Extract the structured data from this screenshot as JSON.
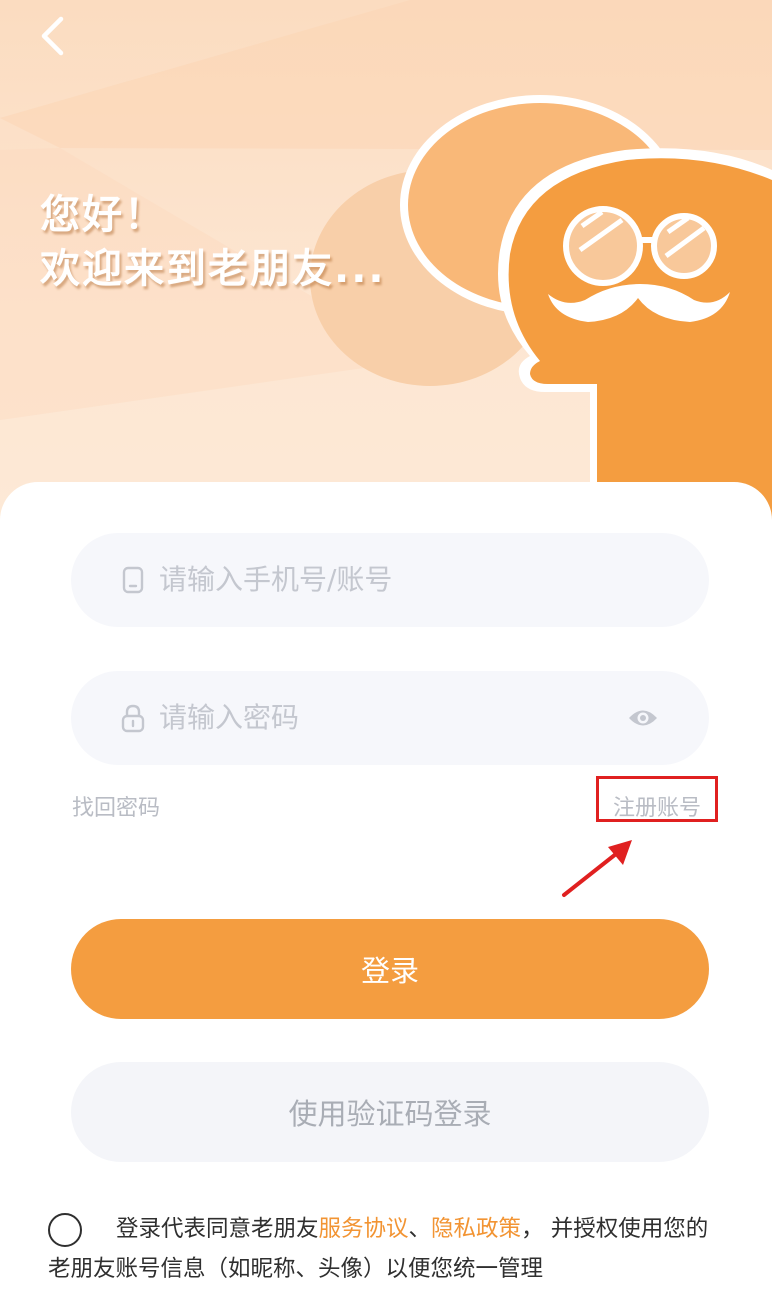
{
  "greeting": {
    "line1": "您好！",
    "line2": "欢迎来到老朋友..."
  },
  "login_form": {
    "account_placeholder": "请输入手机号/账号",
    "password_placeholder": "请输入密码",
    "forgot_password": "找回密码",
    "register": "注册账号"
  },
  "buttons": {
    "login": "登录",
    "code_login": "使用验证码登录"
  },
  "agreement": {
    "prefix": "登录代表同意老朋友",
    "service_link": "服务协议",
    "separator": "、",
    "privacy_link": "隐私政策",
    "suffix": "， 并授权使用您的老朋友账号信息（如昵称、头像）以便您统一管理"
  },
  "icons": {
    "back": "chevron-left-icon",
    "phone": "phone-icon",
    "lock": "lock-icon",
    "eye": "eye-icon",
    "mascot": "mascot-illustration"
  },
  "colors": {
    "accent": "#f49d40",
    "link": "#f29433",
    "highlight_box": "#e02020"
  }
}
